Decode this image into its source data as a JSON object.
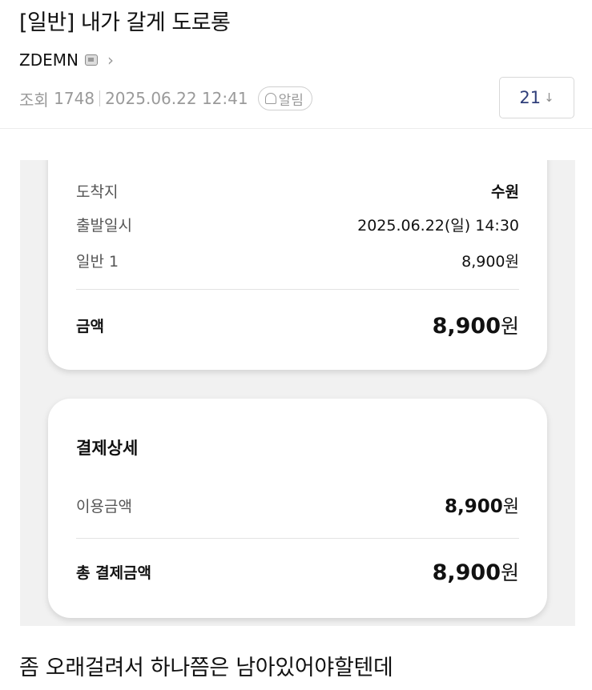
{
  "post": {
    "title": "[일반] 내가 갈게 도로롱",
    "author": "ZDEMN",
    "views_label": "조회",
    "views": "1748",
    "datetime": "2025.06.22 12:41",
    "alarm_label": "알림",
    "comment_count": "21",
    "comment_arrow": "↓"
  },
  "ticket": {
    "rows": [
      {
        "label": "도착지",
        "value": "수원"
      },
      {
        "label": "출발일시",
        "value": "2025.06.22(일) 14:30"
      },
      {
        "label": "일반 1",
        "value": "8,900원"
      }
    ],
    "total_label": "금액",
    "total_amount": "8,900",
    "total_unit": "원"
  },
  "payment": {
    "title": "결제상세",
    "usage_label": "이용금액",
    "usage_amount": "8,900",
    "usage_unit": "원",
    "total_label": "총 결제금액",
    "total_amount": "8,900",
    "total_unit": "원"
  },
  "body_text": "좀 오래걸려서 하나쯤은 남아있어야할텐데",
  "icons": {
    "author_badge": "image-badge-icon",
    "chevron": "chevron-right-icon",
    "bell": "bell-icon"
  },
  "colors": {
    "comment_count": "#2f3e7a",
    "meta_gray": "#9a9a9a"
  }
}
